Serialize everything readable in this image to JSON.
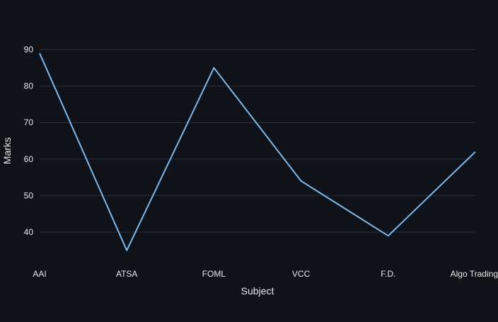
{
  "chart_data": {
    "type": "line",
    "categories": [
      "AAI",
      "ATSA",
      "FOML",
      "VCC",
      "F.D.",
      "Algo Trading"
    ],
    "series": [
      {
        "values": [
          89,
          35,
          85,
          54,
          39,
          62
        ],
        "color": "#7cb9ec"
      }
    ],
    "xlabel": "Subject",
    "ylabel": "Marks",
    "yticks": [
      40,
      50,
      60,
      70,
      80,
      90
    ],
    "ylim": [
      33.5,
      90
    ],
    "grid": true,
    "legend": "none"
  },
  "colors": {
    "background": "#0f1219",
    "gridline": "#2b2f3a",
    "tick_text": "#e6e6e6",
    "axis_title": "#e6e6e6",
    "line": "#7cb9ec"
  }
}
